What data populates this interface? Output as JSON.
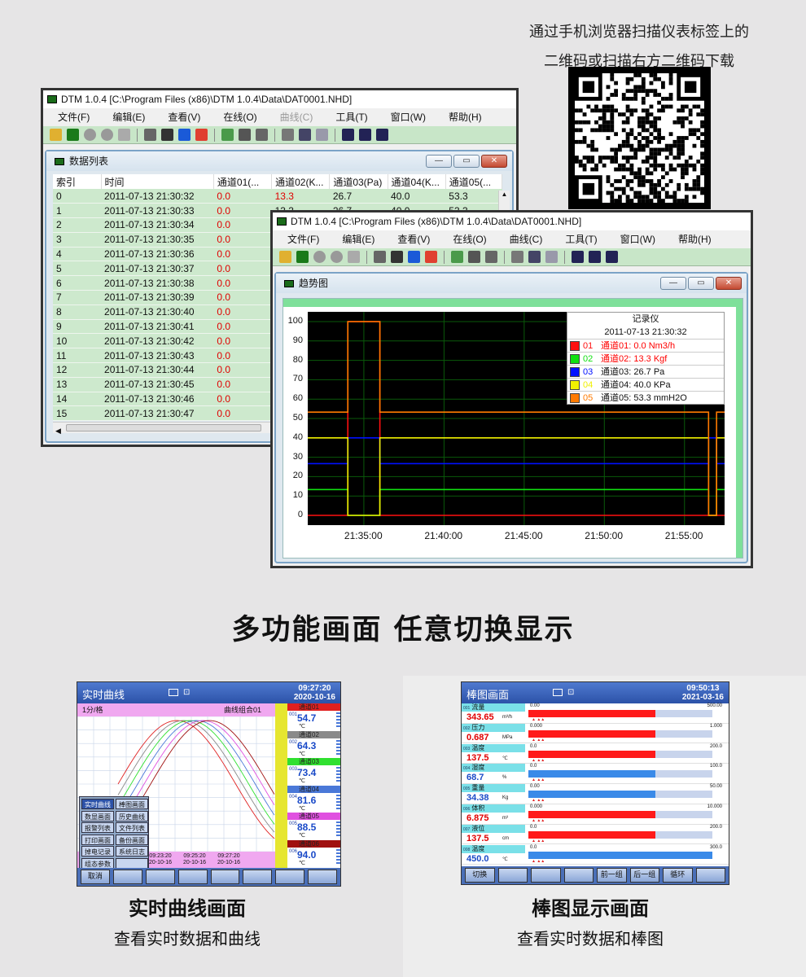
{
  "qr_caption": [
    "通过手机浏览器扫描仪表标签上的",
    "二维码或扫描右方二维码下载"
  ],
  "win1": {
    "title": "DTM 1.0.4 [C:\\Program Files (x86)\\DTM 1.0.4\\Data\\DAT0001.NHD]",
    "menus": [
      "文件(F)",
      "编辑(E)",
      "查看(V)",
      "在线(O)",
      "曲线(C)",
      "工具(T)",
      "窗口(W)",
      "帮助(H)"
    ],
    "inner_title": "数据列表",
    "headers": [
      "索引",
      "时间",
      "通道01(...",
      "通道02(K...",
      "通道03(Pa)",
      "通道04(K...",
      "通道05(..."
    ],
    "rows": [
      [
        "0",
        "2011-07-13 21:30:32",
        "0.0",
        "13.3",
        "26.7",
        "40.0",
        "53.3"
      ],
      [
        "1",
        "2011-07-13 21:30:33",
        "0.0",
        "13.3",
        "26.7",
        "40.0",
        "53.3"
      ],
      [
        "2",
        "2011-07-13 21:30:34",
        "0.0"
      ],
      [
        "3",
        "2011-07-13 21:30:35",
        "0.0"
      ],
      [
        "4",
        "2011-07-13 21:30:36",
        "0.0"
      ],
      [
        "5",
        "2011-07-13 21:30:37",
        "0.0"
      ],
      [
        "6",
        "2011-07-13 21:30:38",
        "0.0"
      ],
      [
        "7",
        "2011-07-13 21:30:39",
        "0.0"
      ],
      [
        "8",
        "2011-07-13 21:30:40",
        "0.0"
      ],
      [
        "9",
        "2011-07-13 21:30:41",
        "0.0"
      ],
      [
        "10",
        "2011-07-13 21:30:42",
        "0.0"
      ],
      [
        "11",
        "2011-07-13 21:30:43",
        "0.0"
      ],
      [
        "12",
        "2011-07-13 21:30:44",
        "0.0"
      ],
      [
        "13",
        "2011-07-13 21:30:45",
        "0.0"
      ],
      [
        "14",
        "2011-07-13 21:30:46",
        "0.0"
      ],
      [
        "15",
        "2011-07-13 21:30:47",
        "0.0"
      ]
    ]
  },
  "win2": {
    "title": "DTM 1.0.4 [C:\\Program Files (x86)\\DTM 1.0.4\\Data\\DAT0001.NHD]",
    "menus": [
      "文件(F)",
      "编辑(E)",
      "查看(V)",
      "在线(O)",
      "曲线(C)",
      "工具(T)",
      "窗口(W)",
      "帮助(H)"
    ],
    "inner_title": "趋势图",
    "legend_title": "记录仪",
    "legend_time": "2011-07-13 21:30:32",
    "legend": [
      {
        "num": "01",
        "text": "通道01: 0.0 Nm3/h",
        "color": "#ff1010",
        "textcolor": "#ff0000"
      },
      {
        "num": "02",
        "text": "通道02: 13.3 Kgf",
        "color": "#10e010",
        "textcolor": "#ff0000"
      },
      {
        "num": "03",
        "text": "通道03: 26.7 Pa",
        "color": "#0010ff",
        "textcolor": "#111111"
      },
      {
        "num": "04",
        "text": "通道04: 40.0 KPa",
        "color": "#f0f000",
        "textcolor": "#111111"
      },
      {
        "num": "05",
        "text": "通道05: 53.3 mmH2O",
        "color": "#ff7a00",
        "textcolor": "#111111"
      }
    ]
  },
  "chart_data": {
    "type": "line",
    "title": "",
    "xlabel": "",
    "ylabel": "",
    "ylim": [
      0,
      100
    ],
    "yticks": [
      0,
      10,
      20,
      30,
      40,
      50,
      60,
      70,
      80,
      90,
      100
    ],
    "xticks": [
      "21:35:00",
      "21:40:00",
      "21:45:00",
      "21:50:00",
      "21:55:00"
    ],
    "xlim_minutes": [
      31.5,
      57.5
    ],
    "series": [
      {
        "name": "通道01",
        "color": "#ff1010",
        "x": [
          31.5,
          34.0,
          34.0,
          36.0,
          36.0,
          56.5,
          56.5,
          57.5
        ],
        "y": [
          0,
          0,
          100,
          100,
          0,
          0,
          0,
          0
        ]
      },
      {
        "name": "通道02",
        "color": "#10e010",
        "x": [
          31.5,
          34.0,
          34.0,
          36.0,
          36.0,
          56.5,
          56.5,
          57.0,
          57.0,
          57.5
        ],
        "y": [
          13.3,
          13.3,
          0,
          0,
          13.3,
          13.3,
          0,
          0,
          13.3,
          13.3
        ]
      },
      {
        "name": "通道03",
        "color": "#0010ff",
        "x": [
          31.5,
          34.0,
          34.0,
          36.0,
          36.0,
          56.5,
          56.5,
          57.0,
          57.0,
          57.5
        ],
        "y": [
          26.7,
          26.7,
          40,
          40,
          26.7,
          26.7,
          40,
          40,
          26.7,
          26.7
        ]
      },
      {
        "name": "通道04",
        "color": "#f0f000",
        "x": [
          31.5,
          34.0,
          34.0,
          36.0,
          36.0,
          56.5,
          56.5,
          57.0,
          57.0,
          57.5
        ],
        "y": [
          40,
          40,
          0,
          0,
          40,
          40,
          0,
          0,
          40,
          40
        ]
      },
      {
        "name": "通道05",
        "color": "#ff7a00",
        "x": [
          31.5,
          34.0,
          34.0,
          36.0,
          36.0,
          56.5,
          56.5,
          57.0,
          57.0,
          57.5
        ],
        "y": [
          53.3,
          53.3,
          100,
          100,
          53.3,
          53.3,
          0,
          0,
          53.3,
          53.3
        ]
      }
    ]
  },
  "headline": "多功能画面  任意切换显示",
  "hmi_curve": {
    "title": "实时曲线",
    "time": "09:27:20",
    "date": "2020-10-16",
    "scale": "1分/格",
    "group": "曲线组合01",
    "xtimes": [
      [
        "09:23:20",
        "20-10-16"
      ],
      [
        "09:25:20",
        "20-10-16"
      ],
      [
        "09:27:20",
        "20-10-16"
      ]
    ],
    "channels": [
      {
        "label": "通道01",
        "code": "001",
        "value": "54.7",
        "unit": "℃",
        "color": "#e02020"
      },
      {
        "label": "通道02",
        "code": "002",
        "value": "64.3",
        "unit": "℃",
        "color": "#8a8a8a"
      },
      {
        "label": "通道03",
        "code": "003",
        "value": "73.4",
        "unit": "℃",
        "color": "#30e030"
      },
      {
        "label": "通道04",
        "code": "004",
        "value": "81.6",
        "unit": "℃",
        "color": "#4a78d8"
      },
      {
        "label": "通道05",
        "code": "005",
        "value": "88.5",
        "unit": "℃",
        "color": "#e050e0"
      },
      {
        "label": "通道06",
        "code": "006",
        "value": "94.0",
        "unit": "℃",
        "color": "#a01010"
      }
    ],
    "menu": [
      [
        "实时曲线",
        "棒图画面"
      ],
      [
        "数显画面",
        "历史曲线"
      ],
      [
        "报警列表",
        "文件列表"
      ],
      [
        "打印画面",
        "备份画面"
      ],
      [
        "掉电记录",
        "系统日志"
      ],
      [
        "组态参数",
        ""
      ]
    ],
    "foot": [
      "取消",
      "",
      "",
      "",
      "",
      "",
      "",
      ""
    ],
    "caption1": "实时曲线画面",
    "caption2": "查看实时数据和曲线"
  },
  "hmi_bar": {
    "title": "棒图画面",
    "time": "09:50:13",
    "date": "2021-03-16",
    "rows": [
      {
        "code": "001",
        "name": "流量",
        "value": "343.65",
        "unit": "m³/h",
        "min": "0.00",
        "max": "500.00",
        "fill": 0.69,
        "color": "#ff1a1a",
        "valcolor": "#e00000"
      },
      {
        "code": "002",
        "name": "压力",
        "value": "0.687",
        "unit": "MPa",
        "min": "0.000",
        "max": "1.000",
        "fill": 0.69,
        "color": "#ff1a1a",
        "valcolor": "#e00000"
      },
      {
        "code": "003",
        "name": "温度",
        "value": "137.5",
        "unit": "℃",
        "min": "0.0",
        "max": "200.0",
        "fill": 0.69,
        "color": "#ff1a1a",
        "valcolor": "#e00000"
      },
      {
        "code": "004",
        "name": "湿度",
        "value": "68.7",
        "unit": "%",
        "min": "0.0",
        "max": "100.0",
        "fill": 0.69,
        "color": "#3a8ae8",
        "valcolor": "#1a4ac8"
      },
      {
        "code": "005",
        "name": "重量",
        "value": "34.38",
        "unit": "Kg",
        "min": "0.00",
        "max": "50.00",
        "fill": 0.69,
        "color": "#3a8ae8",
        "valcolor": "#1a4ac8"
      },
      {
        "code": "006",
        "name": "体积",
        "value": "6.875",
        "unit": "m³",
        "min": "0.000",
        "max": "10.000",
        "fill": 0.69,
        "color": "#ff1a1a",
        "valcolor": "#e00000"
      },
      {
        "code": "007",
        "name": "液位",
        "value": "137.5",
        "unit": "cm",
        "min": "0.0",
        "max": "200.0",
        "fill": 0.69,
        "color": "#ff1a1a",
        "valcolor": "#e00000"
      },
      {
        "code": "008",
        "name": "温度",
        "value": "450.0",
        "unit": "℃",
        "min": "0.0",
        "max": "300.0",
        "fill": 1.0,
        "color": "#3a8ae8",
        "valcolor": "#1a4ac8"
      }
    ],
    "foot": [
      "切换",
      "",
      "",
      "",
      "前一组",
      "后一组",
      "循环",
      ""
    ],
    "caption1": "棒图显示画面",
    "caption2": "查看实时数据和棒图"
  }
}
